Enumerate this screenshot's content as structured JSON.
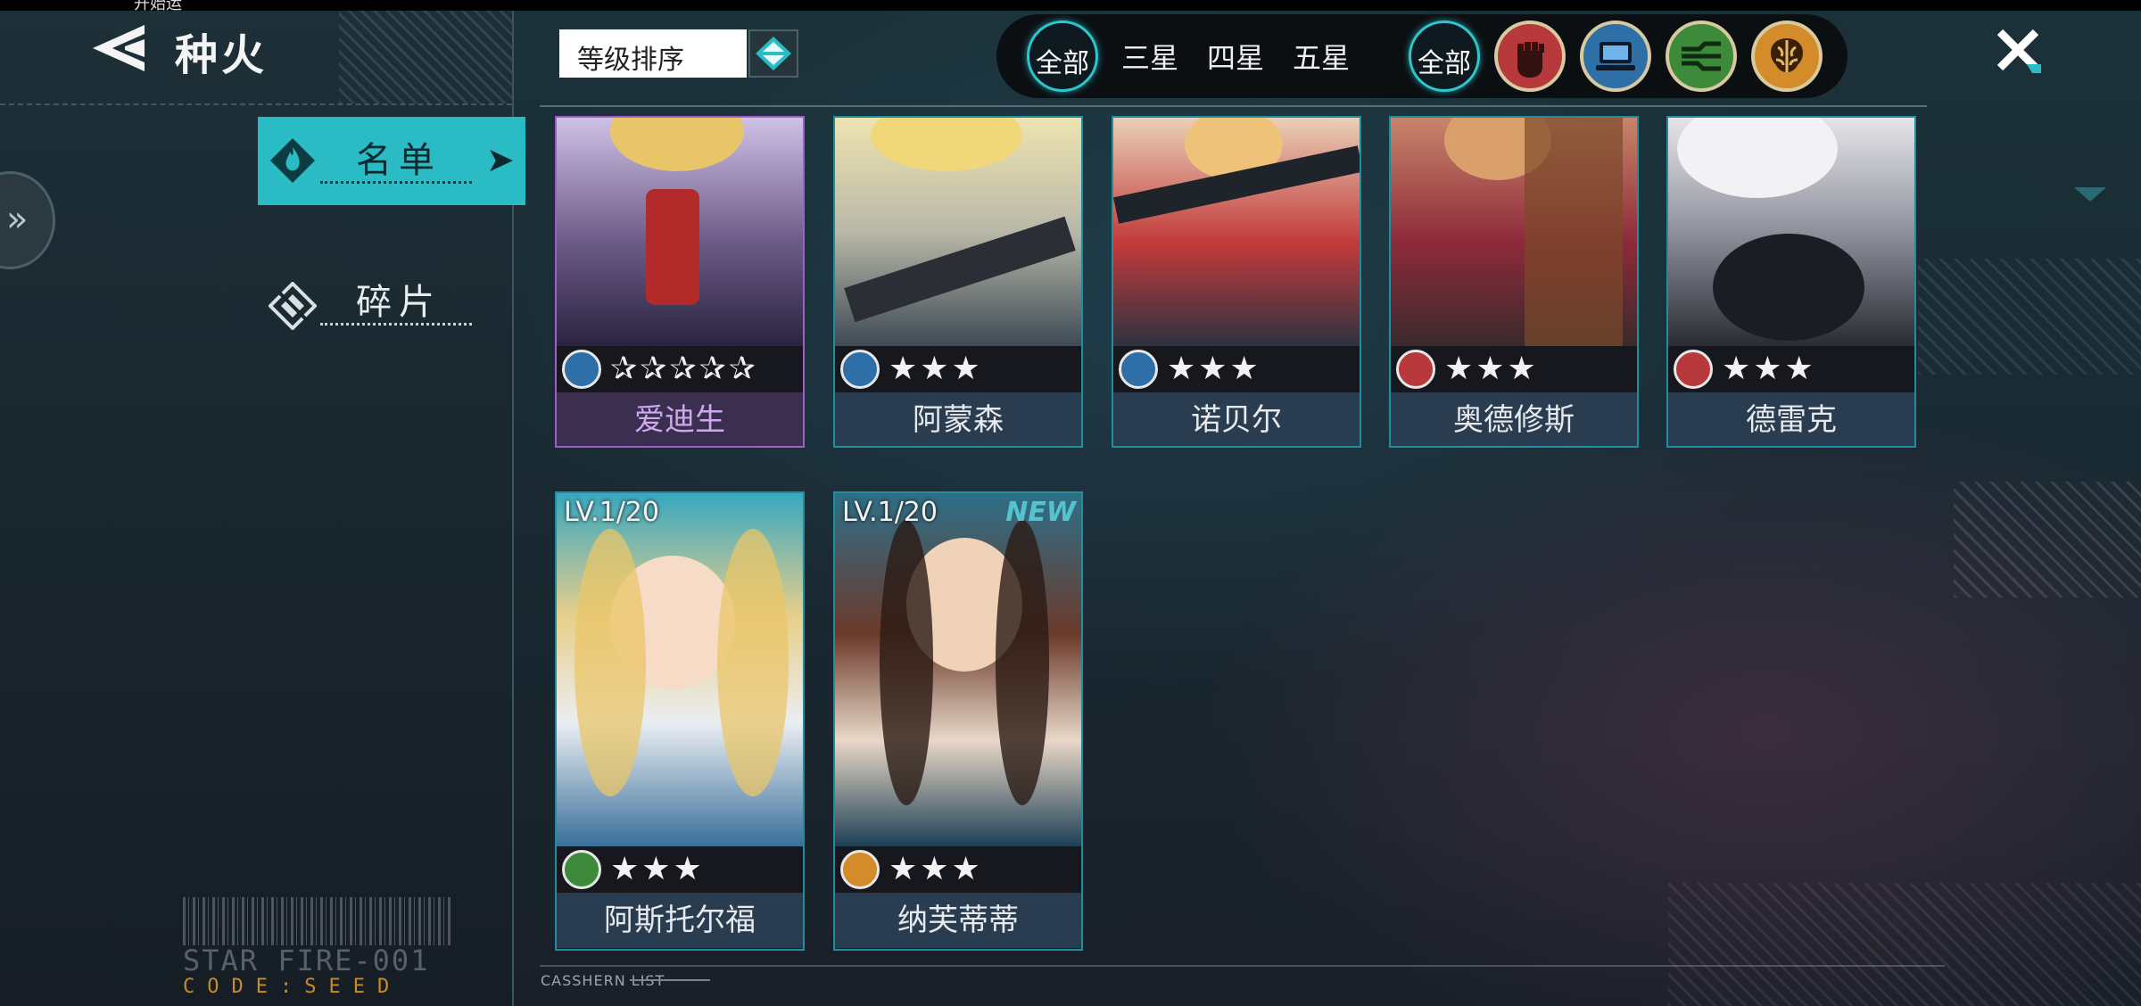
{
  "status_bar": {
    "text": "开始运"
  },
  "header": {
    "title": "种火"
  },
  "sidebar": {
    "items": [
      {
        "label": "名单",
        "active": true
      },
      {
        "label": "碎片",
        "active": false
      }
    ]
  },
  "sort": {
    "label": "等级排序"
  },
  "filters": {
    "rarity": [
      "全部",
      "三星",
      "四星",
      "五星"
    ],
    "class_all": "全部",
    "class_icons": [
      "fist-icon",
      "computer-icon",
      "circuit-icon",
      "brain-icon"
    ]
  },
  "cards": [
    {
      "name": "爱迪生",
      "class_icon": "computer-icon",
      "stars": "✰✰✰✰✰",
      "frame": "purple"
    },
    {
      "name": "阿蒙森",
      "class_icon": "computer-icon",
      "stars": "★★★"
    },
    {
      "name": "诺贝尔",
      "class_icon": "computer-icon",
      "stars": "★★★"
    },
    {
      "name": "奥德修斯",
      "class_icon": "fist-icon",
      "stars": "★★★"
    },
    {
      "name": "德雷克",
      "class_icon": "fist-icon",
      "stars": "★★★"
    },
    {
      "name": "阿斯托尔福",
      "class_icon": "circuit-icon",
      "stars": "★★★",
      "level": "LV.1/20"
    },
    {
      "name": "纳芙蒂蒂",
      "class_icon": "brain-icon",
      "stars": "★★★",
      "level": "LV.1/20",
      "badge": "NEW"
    }
  ],
  "decor": {
    "code_line1": "STAR FIRE-001",
    "code_line2": "CODE:SEED",
    "list_caption": "CASSHERN LIST"
  },
  "colors": {
    "accent": "#2bbbc4",
    "fist": "#b8393b",
    "computer": "#2f6fa8",
    "circuit": "#3d8a3a",
    "brain": "#d48b2a"
  }
}
